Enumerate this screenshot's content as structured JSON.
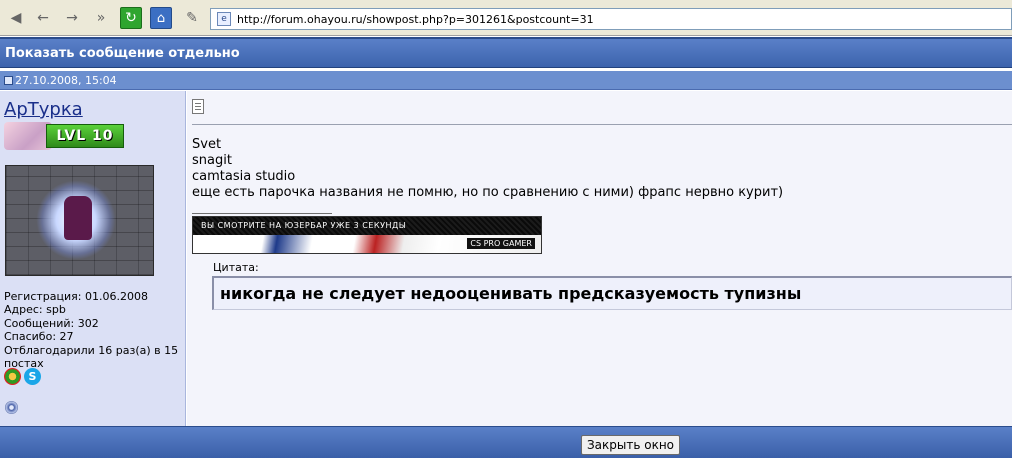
{
  "browser": {
    "url": "http://forum.ohayou.ru/showpost.php?p=301261&postcount=31",
    "icons": [
      "back-icon",
      "forward-icon",
      "forward-fast-icon",
      "double-forward-icon",
      "refresh-icon",
      "home-icon",
      "edit-icon",
      "page-icon"
    ]
  },
  "page": {
    "title": "Показать сообщение отдельно",
    "date": "27.10.2008, 15:04"
  },
  "user": {
    "name": "АрТурка",
    "level_badge": "LVL 10",
    "info": [
      "Регистрация: 01.06.2008",
      "Адрес: spb",
      "Сообщений: 302",
      "Спасибо: 27",
      "Отблагодарили 16 раз(а) в 15 постах"
    ]
  },
  "post": {
    "lines": [
      "Svet",
      "snagit",
      "camtasia studio",
      "еще есть парочка названия не помню, но по сравнению с ними) фрапс нервно курит)"
    ],
    "userbar_text": "ВЫ СМОТРИТЕ НА ЮЗЕРБАР УЖЕ   3  СЕКУНДЫ",
    "userbar_brand": "CS PRO GAMER",
    "quote_label": "Цитата:",
    "quote_text": "никогда не следует недооценивать предсказуемость тупизны"
  },
  "footer": {
    "close_label": "Закрыть окно"
  },
  "colors": {
    "header_blue": "#3c63ad",
    "left_panel": "#dbe0f5",
    "post_bg": "#f3f4fb"
  }
}
